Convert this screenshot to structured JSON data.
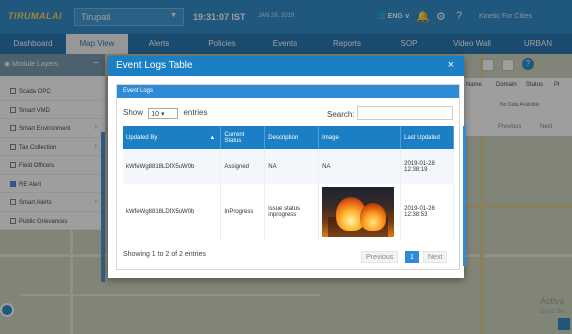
{
  "topbar": {
    "logo_text": "TIRUMALAI",
    "city": "Tirupati",
    "clock": "19:31:07 IST",
    "date": "JAN 28, 2019",
    "lang": "ENG",
    "kinetic": "Kinetic For Cities"
  },
  "nav": [
    {
      "label": "Dashboard"
    },
    {
      "label": "Map View"
    },
    {
      "label": "Alerts"
    },
    {
      "label": "Policies"
    },
    {
      "label": "Events"
    },
    {
      "label": "Reports"
    },
    {
      "label": "SOP"
    },
    {
      "label": "Video Wall"
    },
    {
      "label": "URBAN"
    }
  ],
  "layers": {
    "title": "Module Layers",
    "items": [
      {
        "label": "Scada OPC",
        "checked": false,
        "submenu": false
      },
      {
        "label": "Smart VMD",
        "checked": false,
        "submenu": false
      },
      {
        "label": "Smart Environment",
        "checked": false,
        "submenu": true
      },
      {
        "label": "Tax Collection",
        "checked": false,
        "submenu": true
      },
      {
        "label": "Field Officers",
        "checked": false,
        "submenu": false
      },
      {
        "label": "RE Alert",
        "checked": true,
        "submenu": false
      },
      {
        "label": "Smart Alerts",
        "checked": false,
        "submenu": true
      },
      {
        "label": "Public Grievances",
        "checked": false,
        "submenu": false
      }
    ]
  },
  "right_table": {
    "headers": [
      "Name",
      "Domain",
      "Status",
      "Pr"
    ],
    "empty_text": "No Data Available",
    "prev": "Previous",
    "next": "Next"
  },
  "watermark": {
    "line1": "Activa",
    "line2": "Go to Se"
  },
  "modal": {
    "title": "Event Logs Table",
    "close": "×",
    "panel_title": "Event Logs",
    "show_label": "Show",
    "entries_value": "10",
    "entries_label": "entries",
    "search_label": "Search:",
    "columns": [
      "Updated By",
      "Current Status",
      "Description",
      "Image",
      "Last Updated"
    ],
    "rows": [
      {
        "updated_by": "kWfeWg8818LDfX5uW0b",
        "status": "Assigned",
        "description": "NA",
        "image": "NA",
        "last_updated": "2019-01-28 12:38:19"
      },
      {
        "updated_by": "kWfeWg8818LDfX5uW0b",
        "status": "InProgress",
        "description": "issue status inprogress",
        "image": "fire-photo",
        "last_updated": "2019-01-28 12:38:53"
      }
    ],
    "info": "Showing 1 to 2 of 2 entries",
    "prev": "Previous",
    "page": "1",
    "next": "Next"
  }
}
